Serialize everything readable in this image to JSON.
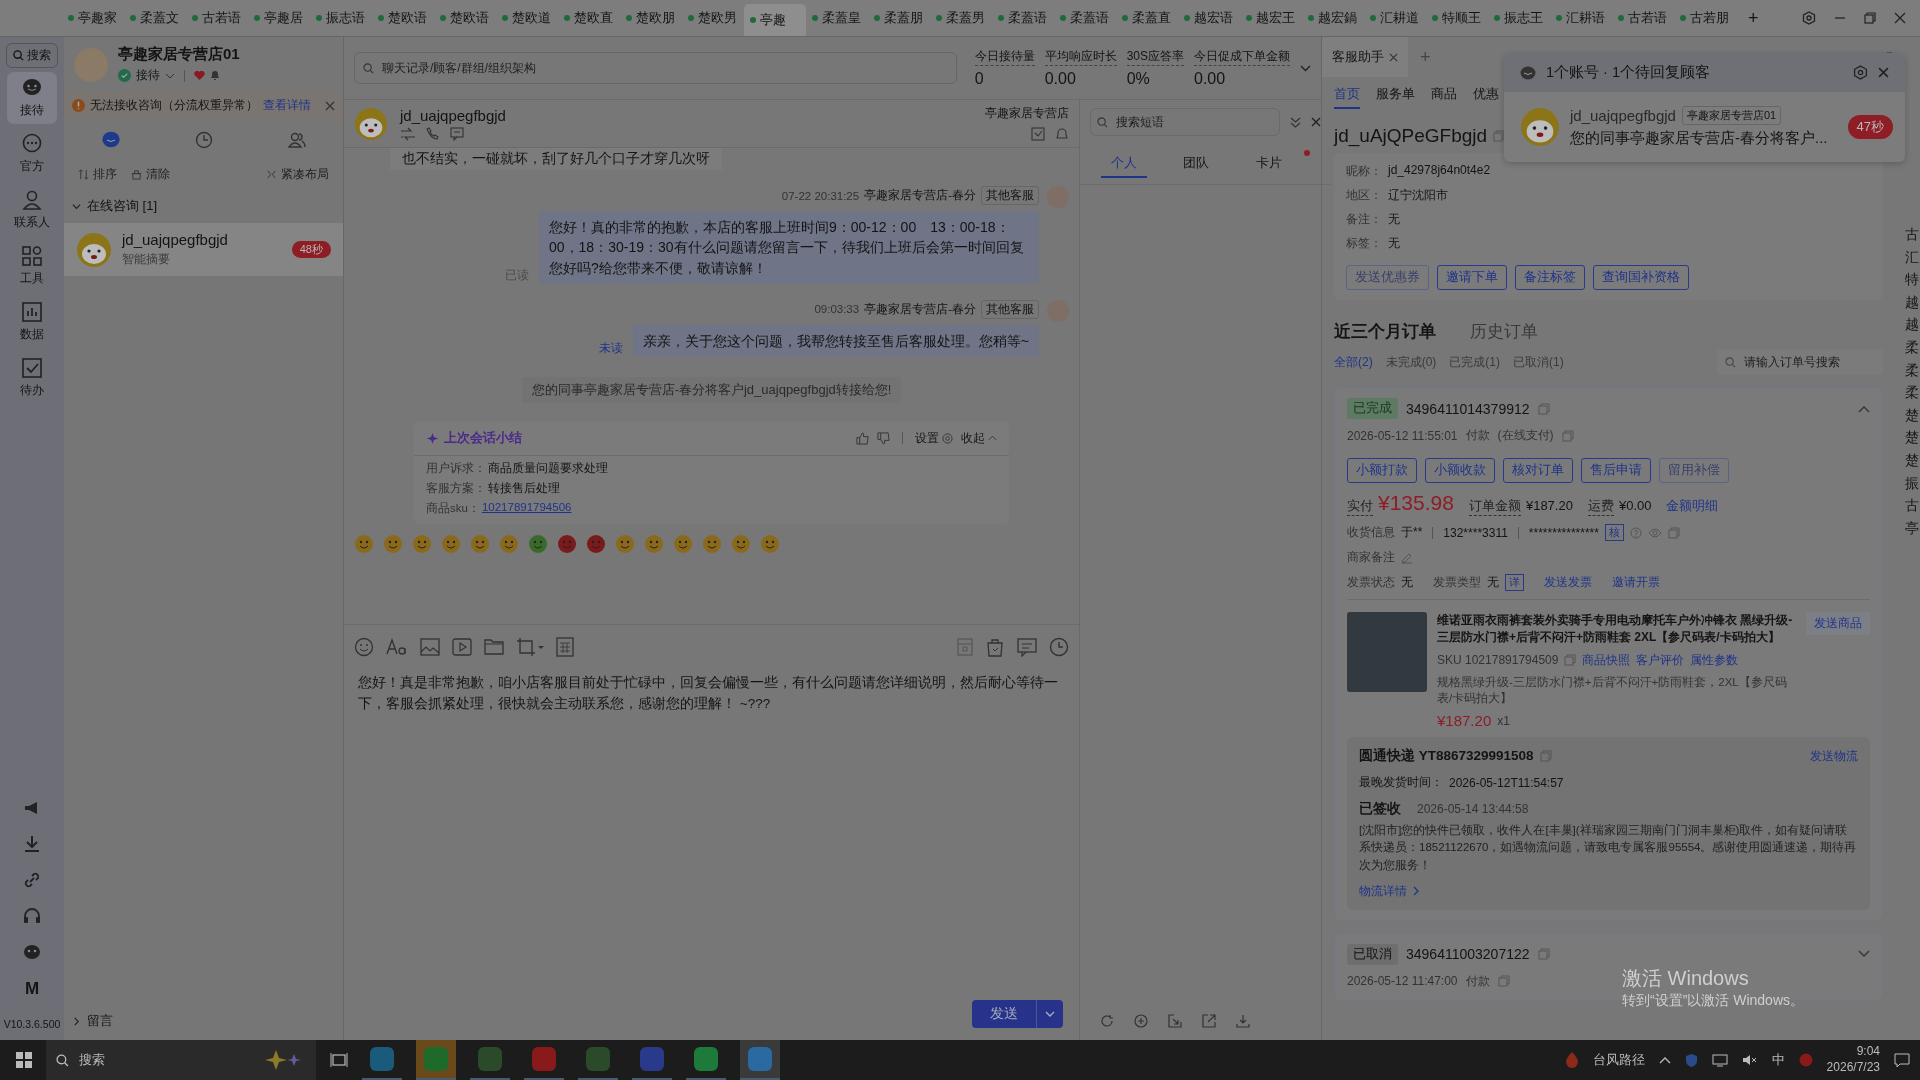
{
  "browser_tabs": [
    {
      "label": "亭趣家",
      "selected": false
    },
    {
      "label": "柔蓋文",
      "selected": false
    },
    {
      "label": "古若语",
      "selected": false
    },
    {
      "label": "亭趣居",
      "selected": false
    },
    {
      "label": "振志语",
      "selected": false
    },
    {
      "label": "楚欧语",
      "selected": false
    },
    {
      "label": "楚欧语",
      "selected": false
    },
    {
      "label": "楚欧道",
      "selected": false
    },
    {
      "label": "楚欧直",
      "selected": false
    },
    {
      "label": "楚欧朋",
      "selected": false
    },
    {
      "label": "楚欧男",
      "selected": false
    },
    {
      "label": "亭趣",
      "selected": true
    },
    {
      "label": "柔蓋皇",
      "selected": false
    },
    {
      "label": "柔蓋朋",
      "selected": false
    },
    {
      "label": "柔蓋男",
      "selected": false
    },
    {
      "label": "柔蓋语",
      "selected": false
    },
    {
      "label": "柔蓋语",
      "selected": false
    },
    {
      "label": "柔蓋直",
      "selected": false
    },
    {
      "label": "越宏语",
      "selected": false
    },
    {
      "label": "越宏王",
      "selected": false
    },
    {
      "label": "越宏鍋",
      "selected": false
    },
    {
      "label": "汇耕道",
      "selected": false
    },
    {
      "label": "特顺王",
      "selected": false
    },
    {
      "label": "振志王",
      "selected": false
    },
    {
      "label": "汇耕语",
      "selected": false
    },
    {
      "label": "古若语",
      "selected": false
    },
    {
      "label": "古若朋",
      "selected": false
    }
  ],
  "new_tab": "+",
  "nav": {
    "search": "搜索",
    "items": [
      {
        "kind": "chat",
        "label": "接待",
        "selected": true
      },
      {
        "kind": "bubble",
        "label": "官方",
        "selected": false
      },
      {
        "kind": "person",
        "label": "联系人",
        "selected": false
      },
      {
        "kind": "grid",
        "label": "工具",
        "selected": false
      },
      {
        "kind": "chart",
        "label": "数据",
        "selected": false
      },
      {
        "kind": "todo",
        "label": "待办",
        "selected": false
      }
    ],
    "tools": [
      {
        "kind": "megaphone"
      },
      {
        "kind": "download"
      },
      {
        "kind": "link"
      },
      {
        "kind": "headset"
      },
      {
        "kind": "bot"
      },
      {
        "kind": "letter",
        "label": "M"
      }
    ],
    "version": "V10.3.6.500"
  },
  "shop": {
    "name": "亭趣家居专营店01",
    "status": "接待"
  },
  "alert": {
    "text": "无法接收咨询（分流权重异常）",
    "link": "查看详情"
  },
  "list_tabs": [
    {
      "kind": "chat",
      "selected": true
    },
    {
      "kind": "clock",
      "selected": false
    },
    {
      "kind": "people",
      "selected": false
    }
  ],
  "list_actions": [
    {
      "kind": "sort",
      "label": "排序"
    },
    {
      "kind": "clear",
      "label": "清除"
    },
    {
      "kind": "compact",
      "label": "紧凑布局"
    }
  ],
  "group": {
    "label": "在线咨询 [1]",
    "expanded": true
  },
  "conversations": [
    {
      "name": "jd_uajqpegfbgjd",
      "subtitle": "智能摘要",
      "badge": "48秒",
      "selected": true
    }
  ],
  "footer_group": {
    "label": "留言",
    "expanded": false
  },
  "chat_search": {
    "placeholder": "聊天记录/顾客/群组/组织架构"
  },
  "stats": [
    {
      "label": "今日接待量",
      "value": "0"
    },
    {
      "label": "平均响应时长",
      "value": "0.00"
    },
    {
      "label": "30S应答率",
      "value": "0%"
    },
    {
      "label": "今日促成下单金额",
      "value": "0.00"
    }
  ],
  "chat": {
    "customer": "jd_uajqpegfbgjd",
    "shop": "亭趣家居专营店",
    "messages": [
      {
        "kind": "customer",
        "text": "也不结实，一碰就坏，刮了好几个口子才穿几次呀"
      },
      {
        "kind": "agent",
        "time": "07-22 20:31:25",
        "sender": "亭趣家居专营店-春分",
        "tag": "其他客服",
        "text": "您好！真的非常的抱歉，本店的客服上班时间9：00-12：00　13：00-18：00，18：30-19：30有什么问题请您留言一下，待我们上班后会第一时间回复您好吗?给您带来不便，敬请谅解！",
        "receipt": "已读",
        "read": true
      },
      {
        "kind": "agent",
        "time": "09:03:33",
        "sender": "亭趣家居专营店-春分",
        "tag": "其他客服",
        "text": "亲亲，关于您这个问题，我帮您转接至售后客服处理。您稍等~",
        "receipt": "未读",
        "read": false
      },
      {
        "kind": "system",
        "text": "您的同事亭趣家居专营店-春分将客户jd_uajqpegfbgjd转接给您!"
      }
    ],
    "summary": {
      "title": "上次会话小结",
      "settings": "设置",
      "collapse": "收起",
      "rows": [
        {
          "label": "用户诉求：",
          "value": "商品质量问题要求处理"
        },
        {
          "label": "客服方案：",
          "value": "转接售后处理"
        },
        {
          "label": "商品sku：",
          "link": "10217891794506"
        }
      ]
    }
  },
  "composer": {
    "value": "您好！真是非常抱歉，咱小店客服目前处于忙碌中，回复会偏慢一些，有什么问题请您详细说明，然后耐心等待一下，客服会抓紧处理，很快就会主动联系您，感谢您的理解！ ~???",
    "send": "发送"
  },
  "phrases": {
    "placeholder": "搜索短语",
    "tabs": [
      {
        "label": "个人",
        "selected": true,
        "dot": false
      },
      {
        "label": "团队",
        "selected": false,
        "dot": false
      },
      {
        "label": "卡片",
        "selected": false,
        "dot": true
      }
    ]
  },
  "assistant": {
    "tab": "客服助手",
    "add": "+",
    "nav": [
      {
        "label": "首页",
        "selected": true
      },
      {
        "label": "服务单",
        "selected": false
      },
      {
        "label": "商品",
        "selected": false
      },
      {
        "label": "优惠",
        "selected": false
      }
    ],
    "customer_id": "jd_uAjQPeGFbgjd",
    "fields": [
      {
        "label": "昵称：",
        "value": "jd_42978j64n0t4e2"
      },
      {
        "label": "地区：",
        "value": "辽宁沈阳市"
      },
      {
        "label": "备注：",
        "value": "无"
      },
      {
        "label": "标签：",
        "value": "无"
      }
    ],
    "actions": [
      {
        "label": "发送优惠券",
        "disabled": true
      },
      {
        "label": "邀请下单",
        "disabled": false
      },
      {
        "label": "备注标签",
        "disabled": false
      },
      {
        "label": "查询国补资格",
        "disabled": false
      }
    ],
    "order_tabs": [
      {
        "label": "近三个月订单",
        "selected": true
      },
      {
        "label": "历史订单",
        "selected": false
      }
    ],
    "filters": [
      {
        "label": "全部(2)",
        "selected": true
      },
      {
        "label": "未完成(0)",
        "selected": false
      },
      {
        "label": "已完成(1)",
        "selected": false
      },
      {
        "label": "已取消(1)",
        "selected": false
      }
    ],
    "order_search": {
      "placeholder": "请输入订单号搜索"
    },
    "orders": [
      {
        "status": "已完成",
        "kind": "done",
        "number": "3496411014379912",
        "time": "2026-05-12 11:55:01",
        "paid_label": "付款",
        "pay_method": "(在线支付)",
        "expanded": true,
        "buttons": [
          {
            "label": "小额打款",
            "disabled": false
          },
          {
            "label": "小额收款",
            "disabled": false
          },
          {
            "label": "核对订单",
            "disabled": false
          },
          {
            "label": "售后申请",
            "disabled": false
          },
          {
            "label": "留用补偿",
            "disabled": true
          }
        ],
        "actual_label": "实付",
        "actual": "¥135.98",
        "total_label": "订单金额",
        "total": "¥187.20",
        "freight_label": "运费",
        "freight": "¥0.00",
        "amount_link": "金额明细",
        "receiver_label": "收货信息",
        "receiver": "于**",
        "phone": "132****3311",
        "address": "***************",
        "verify": "核",
        "note_label": "商家备注",
        "invoice_status_label": "发票状态",
        "invoice_status": "无",
        "invoice_type_label": "发票类型",
        "invoice_type": "无",
        "invoice_detail": "详",
        "invoice_links": [
          "发送发票",
          "邀请开票"
        ],
        "product": {
          "title": "维诺亚雨衣雨裤套装外卖骑手专用电动摩托车户外冲锋衣 黑绿升级-三层防水门襟+后背不闷汗+防雨鞋套 2XL【参尺码表/卡码拍大】",
          "sku": "SKU 10217891794509",
          "links": [
            "商品快照",
            "客户评价",
            "属性参数"
          ],
          "spec": "规格黑绿升级-三层防水门襟+后背不闷汗+防雨鞋套，2XL【参尺码表/卡码拍大】",
          "price": "¥187.20",
          "qty": "x1",
          "send": "发送商品"
        },
        "logistics": {
          "carrier": "圆通快递 YT8867329991508",
          "send": "发送物流",
          "latest_label": "最晚发货时间：",
          "latest": "2026-05-12T11:54:57",
          "state": "已签收",
          "state_time": "2026-05-14 13:44:58",
          "detail": "[沈阳市]您的快件已领取，收件人在[丰巢](祥瑞家园三期南门门洞丰巢柜)取件，如有疑问请联系快递员：18521122670，如遇物流问题，请致电专属客服95554。感谢使用圆通速递，期待再次为您服务！",
          "link": "物流详情"
        }
      },
      {
        "status": "已取消",
        "kind": "cancelled",
        "number": "3496411003207122",
        "time": "2026-05-12 11:47:00",
        "paid_label": "付款",
        "expanded": false
      }
    ]
  },
  "edge_list": [
    "古",
    "汇",
    "特",
    "越",
    "越",
    "柔",
    "柔",
    "柔",
    "楚",
    "楚",
    "楚",
    "振",
    "古",
    "亭"
  ],
  "popup": {
    "title": "1个账号 · 1个待回复顾客",
    "name": "jd_uajqpegfbgjd",
    "shop": "亭趣家居专营店01",
    "message": "您的同事亭趣家居专营店-春分将客户...",
    "badge": "47秒"
  },
  "activation": {
    "title": "激活 Windows",
    "text": "转到“设置”以激活 Windows。"
  },
  "taskbar": {
    "search": "搜索",
    "weather": "台风路径",
    "ime": "中",
    "time": "9:04",
    "date": "2026/7/23"
  }
}
